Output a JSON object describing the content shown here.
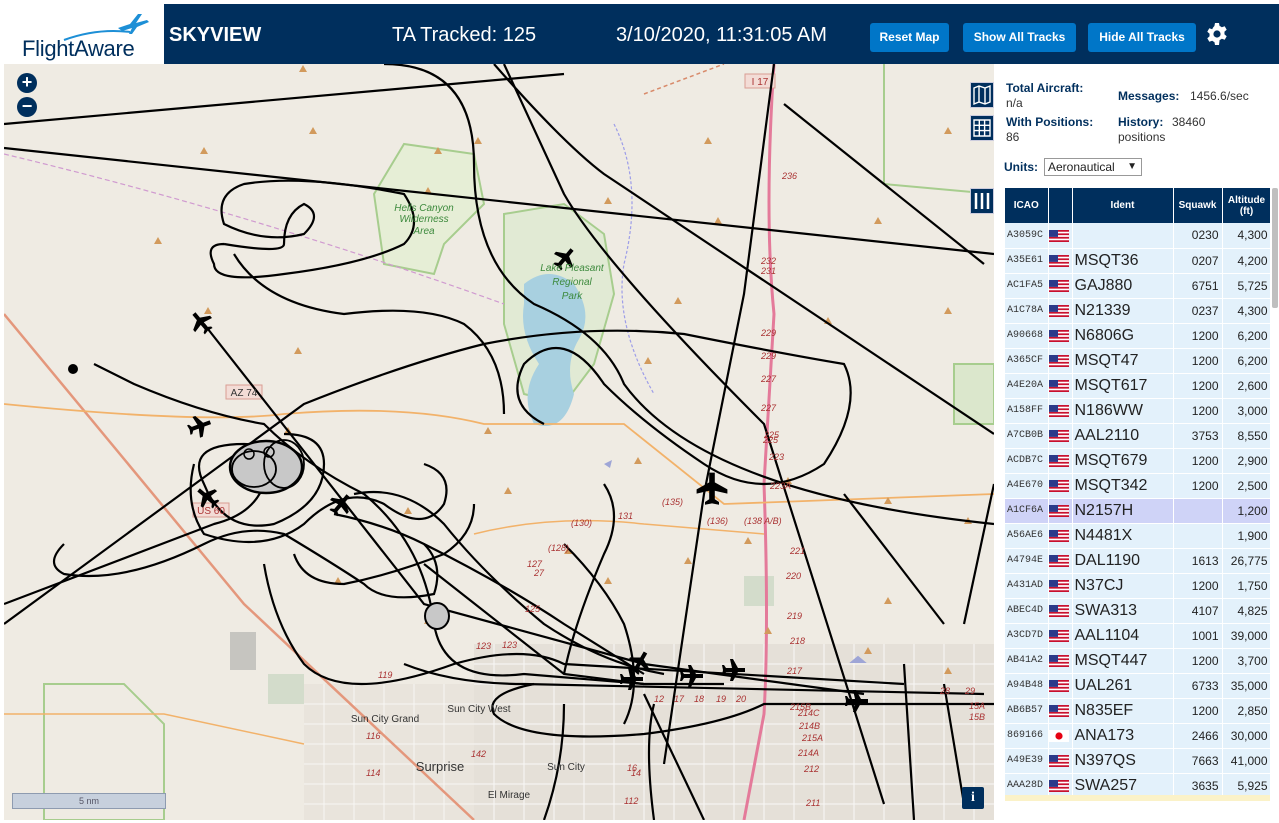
{
  "header": {
    "logo_text": "FlightAware",
    "app_title": "SKYVIEW",
    "ta_tracked": "TA Tracked: 125",
    "clock": "3/10/2020, 11:31:05 AM",
    "buttons": {
      "reset": "Reset Map",
      "show_all": "Show All Tracks",
      "hide_all": "Hide All Tracks"
    },
    "settings_icon": "gear-icon",
    "brand_color": "#002f5d",
    "button_color": "#0076c8"
  },
  "map": {
    "zoom_in": "+",
    "zoom_out": "−",
    "scale": "5 nm",
    "info": "i",
    "labels": {
      "wilderness": [
        "Hells Canyon",
        "Wilderness",
        "Area"
      ],
      "lake": [
        "Lake Pleasant",
        "Regional",
        "Park"
      ],
      "az74": "AZ 74",
      "us60": "US 60",
      "i17": "I 17",
      "sun_city_grand": "Sun City Grand",
      "sun_city_west": "Sun City West",
      "sun_city": "Sun City",
      "surprise": "Surprise",
      "el_mirage": "El Mirage"
    },
    "road_numbers": [
      "236",
      "232",
      "231",
      "229",
      "229",
      "227",
      "227",
      "225",
      "225",
      "223",
      "223A",
      "221",
      "220",
      "219",
      "218",
      "217",
      "215B",
      "215A",
      "214C",
      "214B",
      "214A",
      "212",
      "211",
      "210",
      "209",
      "(130)",
      "131",
      "(135)",
      "(136)",
      "(138 A/B)",
      "(128)",
      "127",
      "27",
      "125",
      "123",
      "123",
      "119",
      "116",
      "114",
      "112",
      "16",
      "14",
      "12",
      "17",
      "18",
      "19",
      "20",
      "142",
      "28",
      "29",
      "15A",
      "15B"
    ]
  },
  "panel": {
    "total_aircraft_label": "Total Aircraft:",
    "total_aircraft_value": "n/a",
    "with_positions_label": "With Positions:",
    "with_positions_value": "86",
    "messages_label": "Messages:",
    "messages_value": "1456.6/sec",
    "history_label": "History:",
    "history_value": "38460",
    "history_unit": "positions",
    "units_label": "Units:",
    "units_value": "Aeronautical",
    "columns": {
      "icao": "ICAO",
      "flag": "",
      "ident": "Ident",
      "squawk": "Squawk",
      "altitude": "Altitude",
      "altitude_unit": "(ft)"
    },
    "rows": [
      {
        "icao": "A3059C",
        "flag": "us",
        "ident": "",
        "squawk": "0230",
        "alt": "4,300"
      },
      {
        "icao": "A35E61",
        "flag": "us",
        "ident": "MSQT36",
        "squawk": "0207",
        "alt": "4,200"
      },
      {
        "icao": "AC1FA5",
        "flag": "us",
        "ident": "GAJ880",
        "squawk": "6751",
        "alt": "5,725"
      },
      {
        "icao": "A1C78A",
        "flag": "us",
        "ident": "N21339",
        "squawk": "0237",
        "alt": "4,300"
      },
      {
        "icao": "A90668",
        "flag": "us",
        "ident": "N6806G",
        "squawk": "1200",
        "alt": "6,200"
      },
      {
        "icao": "A365CF",
        "flag": "us",
        "ident": "MSQT47",
        "squawk": "1200",
        "alt": "6,200"
      },
      {
        "icao": "A4E20A",
        "flag": "us",
        "ident": "MSQT617",
        "squawk": "1200",
        "alt": "2,600"
      },
      {
        "icao": "A158FF",
        "flag": "us",
        "ident": "N186WW",
        "squawk": "1200",
        "alt": "3,000"
      },
      {
        "icao": "A7CB0B",
        "flag": "us",
        "ident": "AAL2110",
        "squawk": "3753",
        "alt": "8,550"
      },
      {
        "icao": "ACDB7C",
        "flag": "us",
        "ident": "MSQT679",
        "squawk": "1200",
        "alt": "2,900"
      },
      {
        "icao": "A4E670",
        "flag": "us",
        "ident": "MSQT342",
        "squawk": "1200",
        "alt": "2,500"
      },
      {
        "icao": "A1CF6A",
        "flag": "us",
        "ident": "N2157H",
        "squawk": "",
        "alt": "1,200",
        "selected": true
      },
      {
        "icao": "A56AE6",
        "flag": "us",
        "ident": "N4481X",
        "squawk": "",
        "alt": "1,900"
      },
      {
        "icao": "A4794E",
        "flag": "us",
        "ident": "DAL1190",
        "squawk": "1613",
        "alt": "26,775"
      },
      {
        "icao": "A431AD",
        "flag": "us",
        "ident": "N37CJ",
        "squawk": "1200",
        "alt": "1,750"
      },
      {
        "icao": "ABEC4D",
        "flag": "us",
        "ident": "SWA313",
        "squawk": "4107",
        "alt": "4,825"
      },
      {
        "icao": "A3CD7D",
        "flag": "us",
        "ident": "AAL1104",
        "squawk": "1001",
        "alt": "39,000"
      },
      {
        "icao": "AB41A2",
        "flag": "us",
        "ident": "MSQT447",
        "squawk": "1200",
        "alt": "3,700"
      },
      {
        "icao": "A94B48",
        "flag": "us",
        "ident": "UAL261",
        "squawk": "6733",
        "alt": "35,000"
      },
      {
        "icao": "AB6B57",
        "flag": "us",
        "ident": "N835EF",
        "squawk": "1200",
        "alt": "2,850"
      },
      {
        "icao": "869166",
        "flag": "jp",
        "ident": "ANA173",
        "squawk": "2466",
        "alt": "30,000"
      },
      {
        "icao": "A49E39",
        "flag": "us",
        "ident": "N397QS",
        "squawk": "7663",
        "alt": "41,000"
      },
      {
        "icao": "AAA28D",
        "flag": "us",
        "ident": "SWA257",
        "squawk": "3635",
        "alt": "5,925"
      }
    ]
  }
}
